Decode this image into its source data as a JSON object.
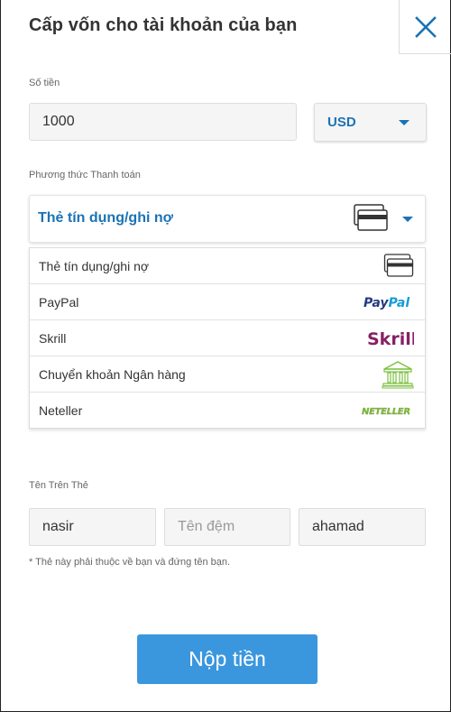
{
  "dialog": {
    "title": "Cấp vốn cho tài khoản của bạn"
  },
  "amount": {
    "label": "Số tiền",
    "value": "1000"
  },
  "currency": {
    "selected": "USD"
  },
  "payment_method": {
    "label": "Phương thức Thanh toán",
    "selected": "Thẻ tín dụng/ghi nợ",
    "options": [
      {
        "label": "Thẻ tín dụng/ghi nợ",
        "icon": "credit-card-icon"
      },
      {
        "label": "PayPal",
        "icon": "paypal-logo",
        "logo_text": "PayPal"
      },
      {
        "label": "Skrill",
        "icon": "skrill-logo",
        "logo_text": "Skrill"
      },
      {
        "label": "Chuyển khoản Ngân hàng",
        "icon": "bank-icon"
      },
      {
        "label": "Neteller",
        "icon": "neteller-logo",
        "logo_text": "NETELLER"
      }
    ]
  },
  "card_name": {
    "label": "Tên Trên Thẻ",
    "first_name_value": "nasir",
    "middle_name_placeholder": "Tên đệm",
    "last_name_value": "ahamad",
    "note": "* Thẻ này phải thuộc về bạn và đứng tên bạn."
  },
  "submit": {
    "label": "Nộp tiền"
  },
  "colors": {
    "accent": "#1a73b5",
    "button": "#3a97de",
    "skrill": "#862165",
    "paypal_dark": "#253b80",
    "paypal_light": "#179bd7",
    "neteller": "#83ba3b",
    "bank": "#7cc243"
  }
}
